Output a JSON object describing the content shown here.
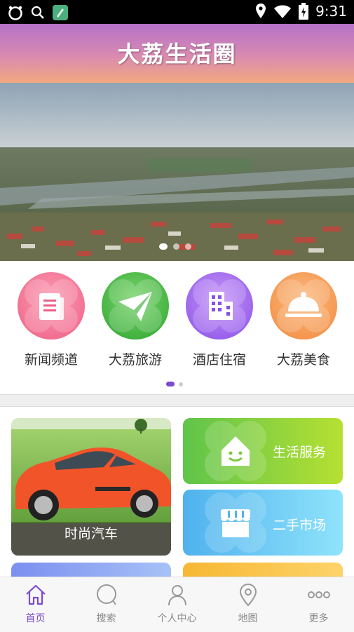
{
  "status_bar": {
    "time": "9:31"
  },
  "header": {
    "title": "大荔生活圈"
  },
  "banner": {
    "slide_count": 3,
    "active_slide": 0
  },
  "categories": [
    {
      "label": "新闻频道",
      "icon": "newspaper-icon",
      "color": "#f06a8c"
    },
    {
      "label": "大荔旅游",
      "icon": "paper-plane-icon",
      "color": "#3fb341"
    },
    {
      "label": "酒店住宿",
      "icon": "building-icon",
      "color": "#9a5cf0"
    },
    {
      "label": "大荔美食",
      "icon": "food-cover-icon",
      "color": "#f59a52"
    }
  ],
  "category_pages": {
    "count": 2,
    "active": 0
  },
  "tiles": {
    "car": {
      "label": "时尚汽车"
    },
    "life": {
      "label": "生活服务",
      "icon": "smiling-house-icon",
      "color": "#8fd140"
    },
    "market": {
      "label": "二手市场",
      "icon": "shop-icon",
      "color": "#56c2f0"
    }
  },
  "tabbar": {
    "items": [
      {
        "label": "首页",
        "icon": "home-icon",
        "active": true
      },
      {
        "label": "搜索",
        "icon": "search-icon",
        "active": false
      },
      {
        "label": "个人中心",
        "icon": "user-icon",
        "active": false
      },
      {
        "label": "地图",
        "icon": "map-pin-icon",
        "active": false
      },
      {
        "label": "更多",
        "icon": "more-icon",
        "active": false
      }
    ],
    "active_color": "#7b4bd1",
    "inactive_color": "#888888"
  }
}
